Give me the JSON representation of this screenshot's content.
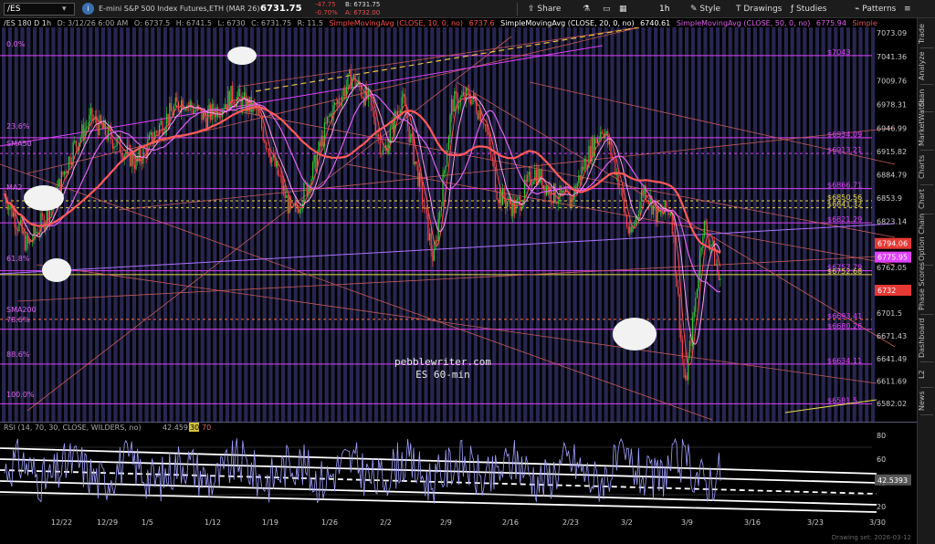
{
  "toolbar": {
    "symbol": "/ES",
    "instrument": "E-mini S&P 500 Index Futures,ETH (MAR 26)",
    "last": "6731.75",
    "change": "-47.75",
    "change_pct": "-0.70%",
    "bid": "B: 6731.75",
    "ask": "A: 6732.00",
    "share": "Share",
    "timeframe": "1h",
    "style": "Style",
    "drawings": "Drawings",
    "studies": "Studies",
    "patterns": "Patterns"
  },
  "header": {
    "ohlc": "/ES 180 D 1h",
    "date": "D: 3/12/26 6:00 AM",
    "open": "O: 6737.5",
    "high": "H: 6741.5",
    "low": "L: 6730",
    "close": "C: 6731.75",
    "range": "R: 11.5",
    "sma10": "SimpleMovingAvg (CLOSE, 10, 0, no)",
    "sma10_val": "6737.6",
    "sma20": "SimpleMovingAvg (CLOSE, 20, 0, no)",
    "sma20_val": "6740.61",
    "sma50": "SimpleMovingAvg (CLOSE, 50, 0, no)",
    "sma50_val": "6775.94",
    "sma_more": "Simple"
  },
  "price_axis": [
    "7073.09",
    "7041.36",
    "7009.76",
    "6978.31",
    "6946.99",
    "6915.82",
    "6884.79",
    "6853.9",
    "6823.14",
    "6762.05",
    "6701.5",
    "6671.43",
    "6641.49",
    "6611.69",
    "6582.02"
  ],
  "price_badges": [
    {
      "label": "6794.06",
      "color": "#e53935"
    },
    {
      "label": "6775.95",
      "color": "#e040fb"
    },
    {
      "label": "6732",
      "color": "#e53935"
    }
  ],
  "fib_labels_left": [
    "0.0%",
    "23.6%",
    "SMA50",
    "MA2",
    "61.8%",
    "SMA200",
    "78.6%",
    "88.6%",
    "100.0%"
  ],
  "fib_labels_right": [
    "$7043",
    "$6934.09",
    "$6913.21",
    "$6866.71",
    "$6850.56",
    "$6841.32",
    "$6821.29",
    "$6757.79",
    "$6752.68",
    "$6693.41",
    "$6680.26",
    "$6634.11",
    "$6581.5"
  ],
  "x_axis": [
    "12/22",
    "12/29",
    "1/5",
    "1/12",
    "1/19",
    "1/26",
    "2/2",
    "2/9",
    "2/16",
    "2/23",
    "3/2",
    "3/9",
    "3/16",
    "3/23",
    "3/30"
  ],
  "watermark": {
    "site": "pebblewriter.com",
    "chart": "ES 60-min"
  },
  "rsi": {
    "label": "RSI (14, 70, 30, CLOSE, WILDERS, no)",
    "value": "42.4592",
    "ob": "30",
    "os": "70",
    "axis": [
      "80",
      "60",
      "40",
      "20"
    ],
    "badge": "42.5393"
  },
  "side_tabs": [
    "Trade",
    "Analyze",
    "Scan",
    "MarketWatch",
    "Charts",
    "Chart",
    "Option Chain",
    "Phase Scores",
    "Dashboard",
    "L2",
    "News"
  ],
  "status": {
    "drawing_set": "Drawing set: 2026-03-12"
  },
  "colors": {
    "sma10": "#ff5050",
    "sma20": "#ffffff",
    "sma50": "#e060f0",
    "fib": "#e040fb",
    "bg": "#000000",
    "band": "#262650"
  }
}
